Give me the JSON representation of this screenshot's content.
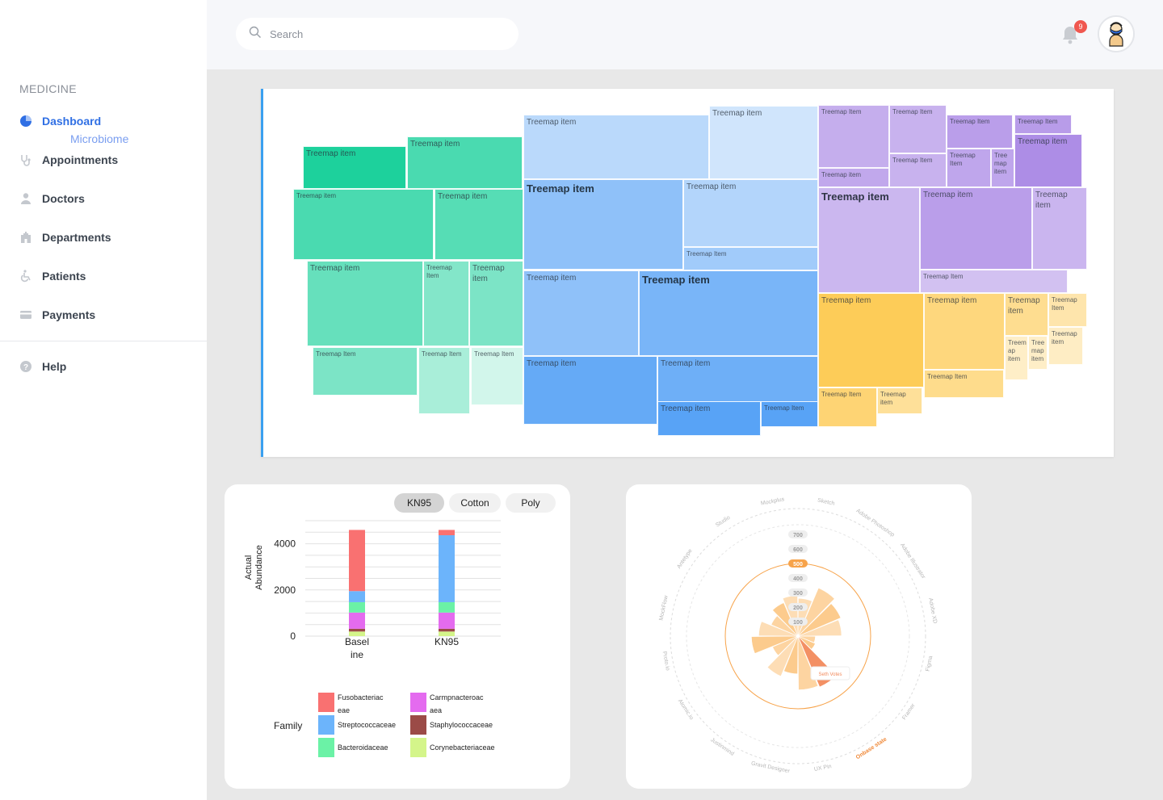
{
  "sidebar": {
    "brand": "MEDICINE",
    "items": [
      {
        "label": "Dashboard",
        "icon": "pie-chart-icon",
        "active": true
      },
      {
        "label": "Appointments",
        "icon": "stethoscope-icon"
      },
      {
        "label": "Doctors",
        "icon": "doctor-icon"
      },
      {
        "label": "Departments",
        "icon": "hospital-icon"
      },
      {
        "label": "Patients",
        "icon": "wheelchair-icon"
      },
      {
        "label": "Payments",
        "icon": "credit-card-icon"
      }
    ],
    "sub_item": "Microbiome",
    "help": "Help"
  },
  "header": {
    "search_placeholder": "Search",
    "notification_count": "9"
  },
  "treemap": {
    "label": "Treemap item",
    "label_alt": "Treemap Item",
    "colors": {
      "green": "#1dd19c",
      "blue": "#4a9bf5",
      "purple": "#a683e4",
      "orange": "#fdc646"
    }
  },
  "bar_chart": {
    "filters": [
      "KN95",
      "Cotton",
      "Poly"
    ],
    "selected_filter": "KN95",
    "chart_data": {
      "type": "bar",
      "stacked": true,
      "categories": [
        "Baseline",
        "KN95"
      ],
      "category_labels": [
        "Basel\nine",
        "KN95"
      ],
      "ylabel": "Actual Abundance",
      "yticks": [
        0,
        2000,
        4000
      ],
      "ylim": [
        0,
        5000
      ],
      "series": [
        {
          "name": "Corynebacteriaceae",
          "color": "#d4f58a",
          "values": [
            200,
            200
          ]
        },
        {
          "name": "Staphylococcaceae",
          "color": "#9b4b47",
          "values": [
            120,
            120
          ]
        },
        {
          "name": "Carmpnacteroaceae",
          "color": "#e46bef",
          "values": [
            700,
            700
          ]
        },
        {
          "name": "Bacteroidaceae",
          "color": "#6bf2a6",
          "values": [
            450,
            450
          ]
        },
        {
          "name": "Streptococcaceae",
          "color": "#6cb4fb",
          "values": [
            480,
            2900
          ]
        },
        {
          "name": "Fusobacteriaceae",
          "color": "#f97171",
          "values": [
            2650,
            230
          ]
        }
      ]
    },
    "legend_title": "Family",
    "legend": [
      {
        "label": "Fusobacteriac\neae",
        "color": "#f97171"
      },
      {
        "label": "Carmpnacteroac\naea",
        "color": "#e46bef"
      },
      {
        "label": "Streptococcaceae",
        "color": "#6cb4fb"
      },
      {
        "label": "Staphylococcaceae",
        "color": "#9b4b47"
      },
      {
        "label": "Bacteroidaceae",
        "color": "#6bf2a6"
      },
      {
        "label": "Corynebacteriaceae",
        "color": "#d4f58a"
      }
    ]
  },
  "polar_chart": {
    "chart_data": {
      "type": "polar-bar",
      "radial_ticks": [
        100,
        200,
        300,
        400,
        500,
        600,
        700
      ],
      "highlight_tick": 500,
      "tooltip": "Seth Votes",
      "categories": [
        "Sketch",
        "Adobe Photoshop",
        "Adobe Illustrator",
        "Adobe XD",
        "Figma",
        "Framer",
        "Onbase state",
        "UX Pin",
        "Gravit Designer",
        "Justinmind",
        "Atomic.io",
        "Proto.io",
        "MockFlow",
        "Antetype",
        "Studio",
        "Mockplus"
      ],
      "values": [
        260,
        360,
        320,
        300,
        120,
        130,
        380,
        370,
        260,
        300,
        190,
        320,
        270,
        200,
        250,
        280
      ],
      "highlight_category": "Onbase state"
    }
  }
}
